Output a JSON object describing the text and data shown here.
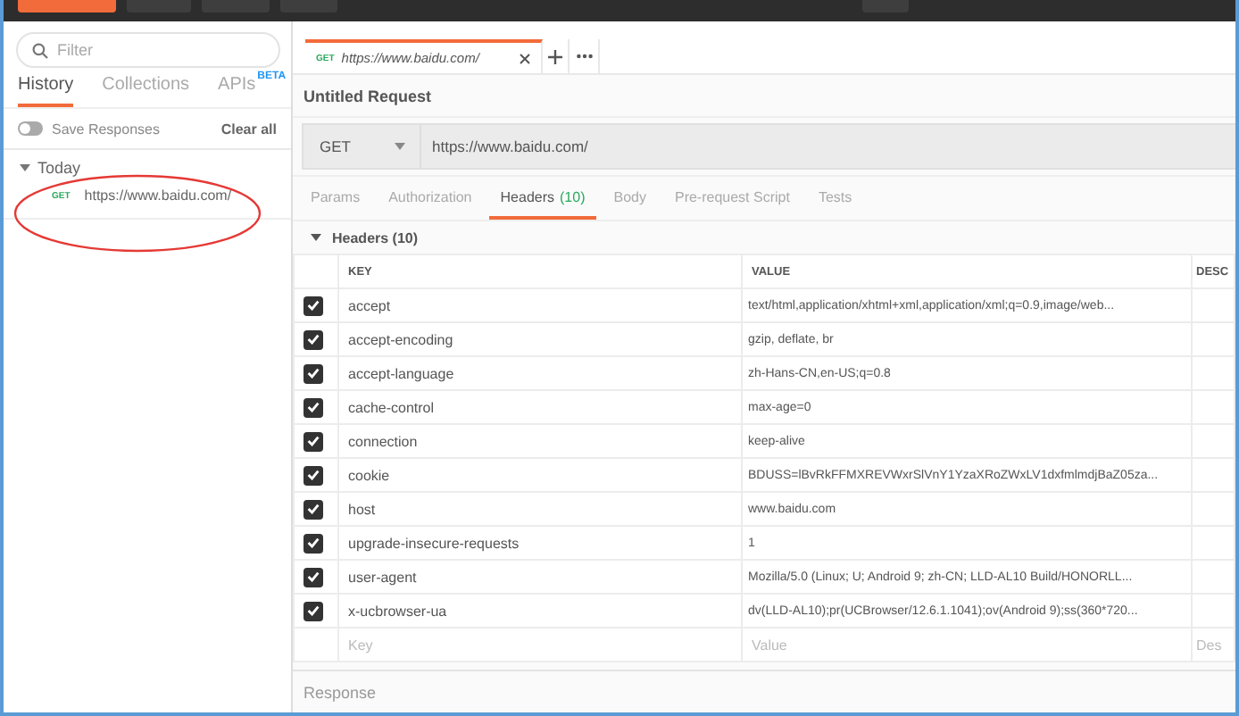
{
  "sidebar": {
    "filter": {
      "placeholder": "Filter"
    },
    "tabs": [
      {
        "label": "History",
        "selected": true
      },
      {
        "label": "Collections",
        "selected": false
      },
      {
        "label": "APIs",
        "badge": "BETA",
        "selected": false
      }
    ],
    "save_responses": {
      "label": "Save Responses",
      "on": false
    },
    "clear_all": "Clear all",
    "history_groups": [
      {
        "label": "Today",
        "expanded": true,
        "items": [
          {
            "method": "GET",
            "url": "https://www.baidu.com/"
          }
        ]
      }
    ]
  },
  "request_tabs": [
    {
      "method": "GET",
      "url": "https://www.baidu.com/",
      "selected": true
    }
  ],
  "request_title": "Untitled Request",
  "url_bar": {
    "method": "GET",
    "url": "https://www.baidu.com/"
  },
  "subtabs": [
    {
      "label": "Params",
      "selected": false
    },
    {
      "label": "Authorization",
      "selected": false
    },
    {
      "label": "Headers",
      "count": "(10)",
      "selected": true
    },
    {
      "label": "Body",
      "selected": false
    },
    {
      "label": "Pre-request Script",
      "selected": false
    },
    {
      "label": "Tests",
      "selected": false
    }
  ],
  "headers_section": {
    "title": "Headers (10)",
    "expanded": true,
    "columns": [
      "KEY",
      "VALUE",
      "DESC"
    ],
    "rows": [
      {
        "key": "accept",
        "value": "text/html,application/xhtml+xml,application/xml;q=0.9,image/web...",
        "checked": true
      },
      {
        "key": "accept-encoding",
        "value": "gzip, deflate, br",
        "checked": true
      },
      {
        "key": "accept-language",
        "value": "zh-Hans-CN,en-US;q=0.8",
        "checked": true
      },
      {
        "key": "cache-control",
        "value": "max-age=0",
        "checked": true
      },
      {
        "key": "connection",
        "value": "keep-alive",
        "checked": true
      },
      {
        "key": "cookie",
        "value": "BDUSS=lBvRkFFMXREVWxrSlVnY1YzaXRoZWxLV1dxfmlmdjBaZ05za...",
        "checked": true
      },
      {
        "key": "host",
        "value": "www.baidu.com",
        "checked": true
      },
      {
        "key": "upgrade-insecure-requests",
        "value": "1",
        "checked": true
      },
      {
        "key": "user-agent",
        "value": "Mozilla/5.0 (Linux; U; Android 9; zh-CN; LLD-AL10 Build/HONORLL...",
        "checked": true
      },
      {
        "key": "x-ucbrowser-ua",
        "value": "dv(LLD-AL10);pr(UCBrowser/12.6.1.1041);ov(Android 9);ss(360*720...",
        "checked": true
      }
    ],
    "new_row": {
      "key_placeholder": "Key",
      "value_placeholder": "Value",
      "description_placeholder": "Des"
    }
  },
  "response_label": "Response"
}
